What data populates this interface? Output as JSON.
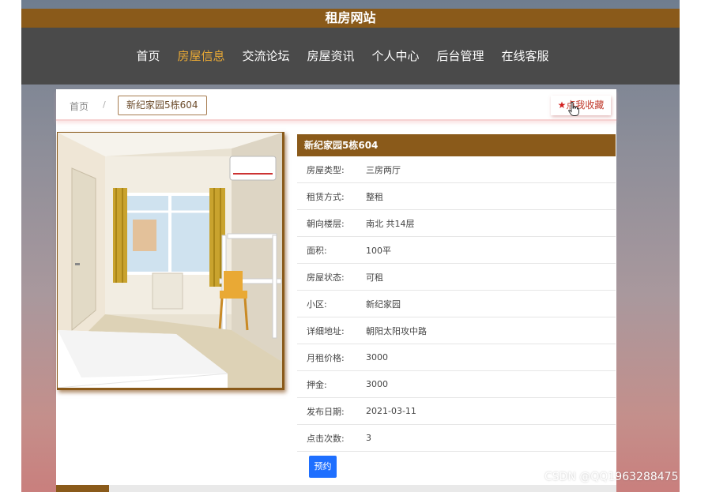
{
  "site": {
    "title": "租房网站"
  },
  "nav": [
    {
      "label": "首页",
      "active": false
    },
    {
      "label": "房屋信息",
      "active": true
    },
    {
      "label": "交流论坛",
      "active": false
    },
    {
      "label": "房屋资讯",
      "active": false
    },
    {
      "label": "个人中心",
      "active": false
    },
    {
      "label": "后台管理",
      "active": false
    },
    {
      "label": "在线客服",
      "active": false
    }
  ],
  "breadcrumb": {
    "home": "首页",
    "separator": "/",
    "current": "新纪家园5栋604"
  },
  "favorite": {
    "star": "★",
    "label": "点我收藏"
  },
  "detail": {
    "title": "新纪家园5栋604",
    "rows": [
      {
        "key": "房屋类型:",
        "value": "三房两厅"
      },
      {
        "key": "租赁方式:",
        "value": "整租"
      },
      {
        "key": "朝向楼层:",
        "value": "南北 共14层"
      },
      {
        "key": "面积:",
        "value": "100平"
      },
      {
        "key": "房屋状态:",
        "value": "可租"
      },
      {
        "key": "小区:",
        "value": "新纪家园"
      },
      {
        "key": "详细地址:",
        "value": "朝阳太阳攻中路"
      },
      {
        "key": "月租价格:",
        "value": "3000"
      },
      {
        "key": "押金:",
        "value": "3000"
      },
      {
        "key": "发布日期:",
        "value": "2021-03-11"
      },
      {
        "key": "点击次数:",
        "value": "3"
      }
    ],
    "reserve_label": "预约"
  },
  "watermark": "CSDN @QQ1963288475",
  "colors": {
    "brand": "#8a5a1a",
    "nav_bg": "#4a4a4a",
    "active": "#e9a935",
    "button": "#1e6fff"
  }
}
